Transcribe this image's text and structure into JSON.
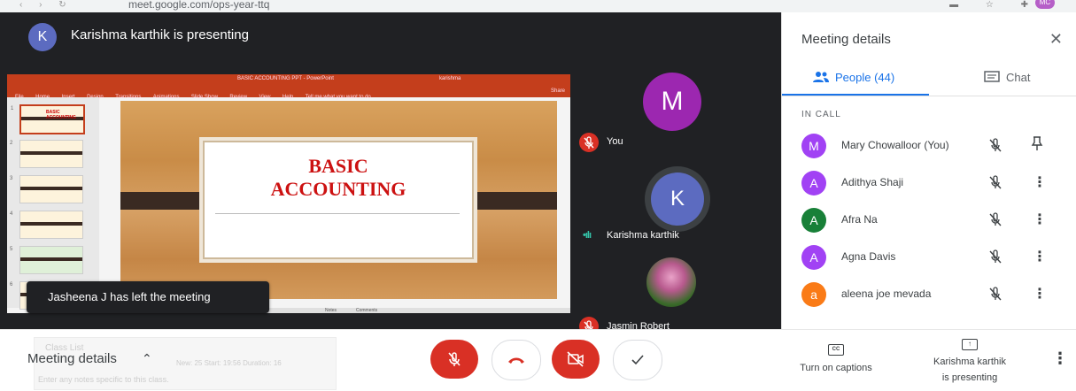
{
  "browser": {
    "url": "meet.google.com/ops-year-ttq",
    "profile_initials": "MC"
  },
  "presenter": {
    "initial": "K",
    "banner": "Karishma karthik is presenting"
  },
  "powerpoint": {
    "window_title": "BASIC ACCOUNTING PPT - PowerPoint",
    "user": "karishma",
    "menu": [
      "File",
      "Home",
      "Insert",
      "Design",
      "Transitions",
      "Animations",
      "Slide Show",
      "Review",
      "View",
      "Help",
      "Tell me what you want to do"
    ],
    "share": "Share",
    "thumb_numbers": [
      "1",
      "2",
      "3",
      "4",
      "5",
      "6"
    ],
    "slide_title": "BASIC\nACCOUNTING",
    "thumb1_title": "BASIC ACCOUNTING",
    "status_notes": "Notes",
    "status_comments": "Comments"
  },
  "toast": "Jasheena J has left the meeting",
  "tiles": [
    {
      "name": "You",
      "initial": "M"
    },
    {
      "name": "Karishma karthik",
      "initial": "K"
    },
    {
      "name": "Jasmin Robert"
    }
  ],
  "side_panel": {
    "title": "Meeting details",
    "tab_people": "People (44)",
    "tab_chat": "Chat",
    "section": "IN CALL",
    "participants": [
      {
        "name": "Mary Chowalloor (You)",
        "initial": "M",
        "color": "#a142f4"
      },
      {
        "name": "Adithya Shaji",
        "initial": "A",
        "color": "#a142f4"
      },
      {
        "name": "Afra Na",
        "initial": "A",
        "color": "#188038"
      },
      {
        "name": "Agna Davis",
        "initial": "A",
        "color": "#a142f4"
      },
      {
        "name": "aleena joe mevada",
        "initial": "a",
        "color": "#fa7b17"
      }
    ]
  },
  "bottom_bar": {
    "meeting_details": "Meeting details",
    "ghost_class_list": "Class List",
    "ghost_meta": "New: 25   Start: 19:56   Duration: 16",
    "ghost_notes": "Enter any notes specific to this class.",
    "captions": "Turn on captions",
    "presenting": "Karishma karthik\nis presenting"
  }
}
